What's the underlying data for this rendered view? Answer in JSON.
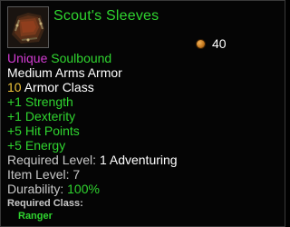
{
  "item": {
    "name": "Scout's Sleeves",
    "icon": "leather-sleeves-icon",
    "price": "40",
    "price_icon": "copper-coin-icon",
    "rarity": "Unique",
    "binding": "Soulbound",
    "type": "Medium Arms Armor",
    "armor_value": "10",
    "armor_label": " Armor Class",
    "stats": [
      "+1 Strength",
      "+1 Dexterity",
      "+5 Hit Points",
      "+5 Energy"
    ],
    "required_level_label": "Required Level: ",
    "required_level_value": "1 Adventuring",
    "item_level": "Item Level: 7",
    "durability_label": "Durability: ",
    "durability_value": "100%",
    "required_class_label": "Required Class:",
    "required_class_value": "Ranger"
  },
  "colors": {
    "name": "#2fd42f",
    "rarity": "#d23bd2",
    "binding": "#2fd42f",
    "stat": "#2fd42f",
    "armor_value": "#f2c63a",
    "label": "#c8c8c8"
  }
}
